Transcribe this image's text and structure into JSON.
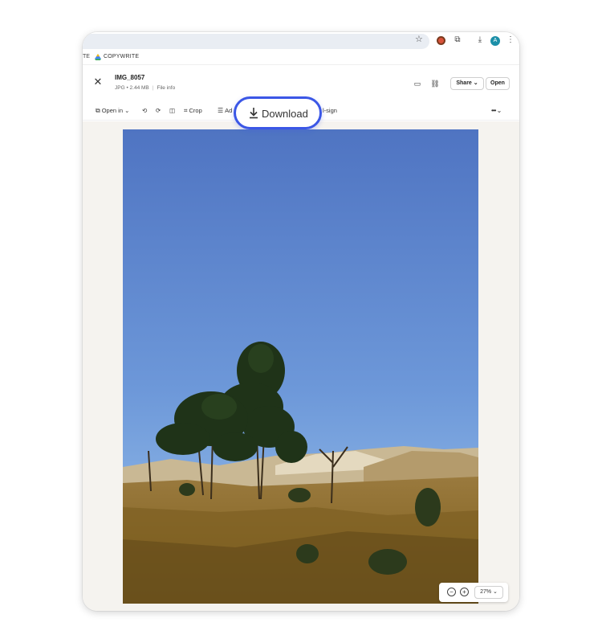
{
  "browser": {
    "bookmark_truncated": "TE",
    "bookmark_label": "COPYWRITE",
    "avatar_letter": "A"
  },
  "viewer": {
    "file_name": "IMG_8057",
    "file_meta": "JPG • 2.44 MB",
    "file_info_link": "File info",
    "share_label": "Share",
    "open_label": "Open"
  },
  "toolbar": {
    "open_in_label": "Open in",
    "crop_label": "Crop",
    "adjust_label_visible": "Ad",
    "fill_sign_label_visible": "l-sign",
    "download_label": "Download"
  },
  "zoom": {
    "level": "27%"
  },
  "colors": {
    "accent": "#3b57e6",
    "sky_top": "#4f74c2",
    "sky_bottom": "#86b5e6",
    "ground": "#8a6a2a",
    "canvas_bg": "#f5f3ef"
  },
  "icons": {
    "close": "close-icon",
    "comment": "comment-icon",
    "link": "link-icon",
    "download": "download-icon",
    "zoom_out": "zoom-out-icon",
    "zoom_in": "zoom-in-icon"
  }
}
